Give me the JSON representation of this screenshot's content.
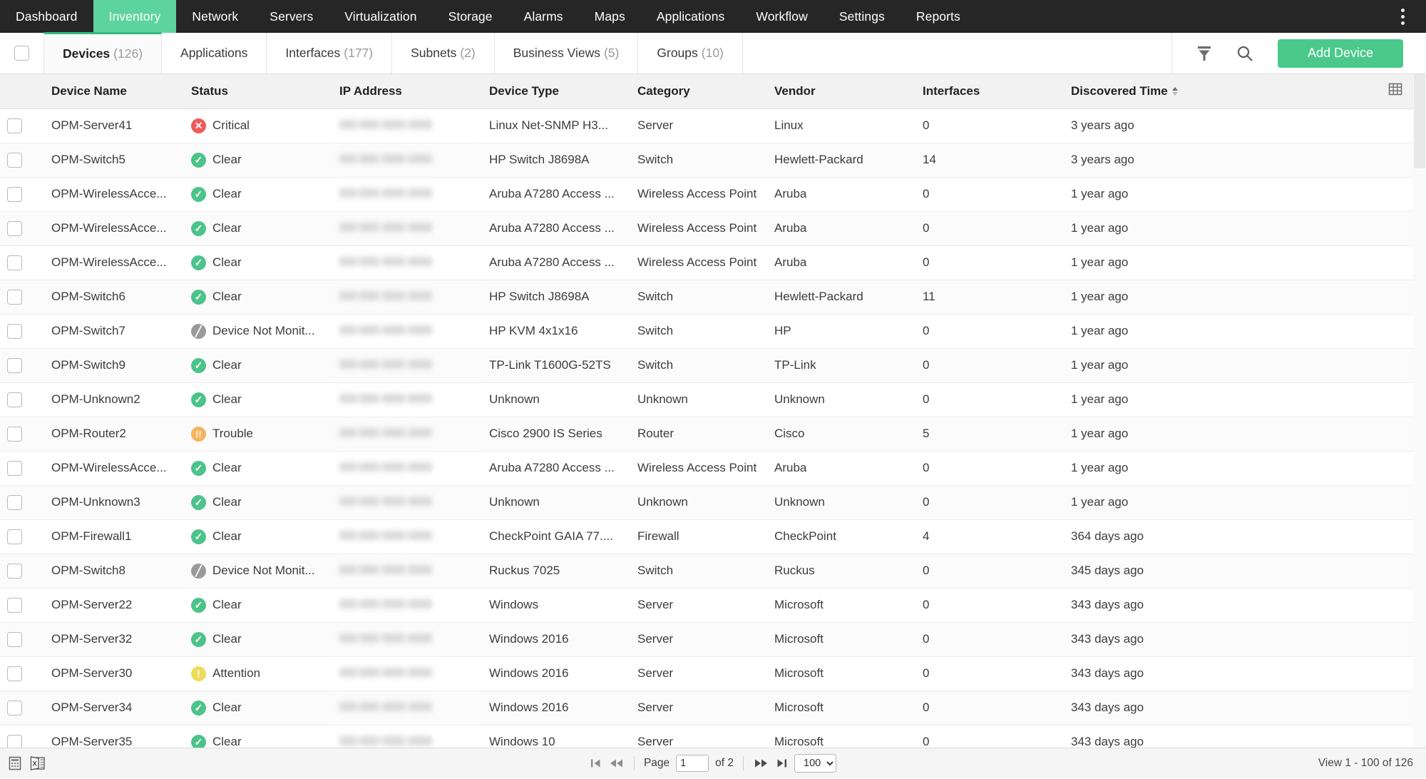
{
  "topnav": {
    "items": [
      {
        "label": "Dashboard",
        "active": false
      },
      {
        "label": "Inventory",
        "active": true
      },
      {
        "label": "Network",
        "active": false
      },
      {
        "label": "Servers",
        "active": false
      },
      {
        "label": "Virtualization",
        "active": false
      },
      {
        "label": "Storage",
        "active": false
      },
      {
        "label": "Alarms",
        "active": false
      },
      {
        "label": "Maps",
        "active": false
      },
      {
        "label": "Applications",
        "active": false
      },
      {
        "label": "Workflow",
        "active": false
      },
      {
        "label": "Settings",
        "active": false
      },
      {
        "label": "Reports",
        "active": false
      }
    ],
    "active_color": "#5dd39e",
    "background": "#262626"
  },
  "tabs": [
    {
      "label": "Devices",
      "count": "(126)",
      "active": true
    },
    {
      "label": "Applications",
      "count": "",
      "active": false
    },
    {
      "label": "Interfaces",
      "count": "(177)",
      "active": false
    },
    {
      "label": "Subnets",
      "count": "(2)",
      "active": false
    },
    {
      "label": "Business Views",
      "count": "(5)",
      "active": false
    },
    {
      "label": "Groups",
      "count": "(10)",
      "active": false
    }
  ],
  "toolbar": {
    "filter_icon": "filter-icon",
    "search_icon": "search-icon",
    "add_device_label": "Add Device",
    "add_device_color": "#4ac98b"
  },
  "table": {
    "columns": [
      "Device Name",
      "Status",
      "IP Address",
      "Device Type",
      "Category",
      "Vendor",
      "Interfaces",
      "Discovered Time"
    ],
    "sorted_column": "Discovered Time",
    "sort_direction": "asc",
    "column_chooser_icon": "grid-settings-icon",
    "rows": [
      {
        "name": "OPM-Server41",
        "status": "Critical",
        "status_type": "critical",
        "ip": "",
        "type": "Linux Net-SNMP H3...",
        "category": "Server",
        "vendor": "Linux",
        "interfaces": "0",
        "discovered": "3 years ago"
      },
      {
        "name": "OPM-Switch5",
        "status": "Clear",
        "status_type": "clear",
        "ip": "",
        "type": "HP Switch J8698A",
        "category": "Switch",
        "vendor": "Hewlett-Packard",
        "interfaces": "14",
        "discovered": "3 years ago"
      },
      {
        "name": "OPM-WirelessAcce...",
        "status": "Clear",
        "status_type": "clear",
        "ip": "",
        "type": "Aruba A7280 Access ...",
        "category": "Wireless Access Point",
        "vendor": "Aruba",
        "interfaces": "0",
        "discovered": "1 year ago"
      },
      {
        "name": "OPM-WirelessAcce...",
        "status": "Clear",
        "status_type": "clear",
        "ip": "",
        "type": "Aruba A7280 Access ...",
        "category": "Wireless Access Point",
        "vendor": "Aruba",
        "interfaces": "0",
        "discovered": "1 year ago"
      },
      {
        "name": "OPM-WirelessAcce...",
        "status": "Clear",
        "status_type": "clear",
        "ip": "",
        "type": "Aruba A7280 Access ...",
        "category": "Wireless Access Point",
        "vendor": "Aruba",
        "interfaces": "0",
        "discovered": "1 year ago"
      },
      {
        "name": "OPM-Switch6",
        "status": "Clear",
        "status_type": "clear",
        "ip": "",
        "type": "HP Switch J8698A",
        "category": "Switch",
        "vendor": "Hewlett-Packard",
        "interfaces": "11",
        "discovered": "1 year ago"
      },
      {
        "name": "OPM-Switch7",
        "status": "Device Not Monit...",
        "status_type": "nomon",
        "ip": "",
        "type": "HP KVM 4x1x16",
        "category": "Switch",
        "vendor": "HP",
        "interfaces": "0",
        "discovered": "1 year ago"
      },
      {
        "name": "OPM-Switch9",
        "status": "Clear",
        "status_type": "clear",
        "ip": "",
        "type": "TP-Link T1600G-52TS",
        "category": "Switch",
        "vendor": "TP-Link",
        "interfaces": "0",
        "discovered": "1 year ago"
      },
      {
        "name": "OPM-Unknown2",
        "status": "Clear",
        "status_type": "clear",
        "ip": "",
        "type": "Unknown",
        "category": "Unknown",
        "vendor": "Unknown",
        "interfaces": "0",
        "discovered": "1 year ago"
      },
      {
        "name": "OPM-Router2",
        "status": "Trouble",
        "status_type": "trouble",
        "ip": "",
        "type": "Cisco 2900 IS Series",
        "category": "Router",
        "vendor": "Cisco",
        "interfaces": "5",
        "discovered": "1 year ago"
      },
      {
        "name": "OPM-WirelessAcce...",
        "status": "Clear",
        "status_type": "clear",
        "ip": "",
        "type": "Aruba A7280 Access ...",
        "category": "Wireless Access Point",
        "vendor": "Aruba",
        "interfaces": "0",
        "discovered": "1 year ago"
      },
      {
        "name": "OPM-Unknown3",
        "status": "Clear",
        "status_type": "clear",
        "ip": "",
        "type": "Unknown",
        "category": "Unknown",
        "vendor": "Unknown",
        "interfaces": "0",
        "discovered": "1 year ago"
      },
      {
        "name": "OPM-Firewall1",
        "status": "Clear",
        "status_type": "clear",
        "ip": "",
        "type": "CheckPoint GAIA 77....",
        "category": "Firewall",
        "vendor": "CheckPoint",
        "interfaces": "4",
        "discovered": "364 days ago"
      },
      {
        "name": "OPM-Switch8",
        "status": "Device Not Monit...",
        "status_type": "nomon",
        "ip": "",
        "type": "Ruckus 7025",
        "category": "Switch",
        "vendor": "Ruckus",
        "interfaces": "0",
        "discovered": "345 days ago"
      },
      {
        "name": "OPM-Server22",
        "status": "Clear",
        "status_type": "clear",
        "ip": "",
        "type": "Windows",
        "category": "Server",
        "vendor": "Microsoft",
        "interfaces": "0",
        "discovered": "343 days ago"
      },
      {
        "name": "OPM-Server32",
        "status": "Clear",
        "status_type": "clear",
        "ip": "",
        "type": "Windows 2016",
        "category": "Server",
        "vendor": "Microsoft",
        "interfaces": "0",
        "discovered": "343 days ago"
      },
      {
        "name": "OPM-Server30",
        "status": "Attention",
        "status_type": "attention",
        "ip": "",
        "type": "Windows 2016",
        "category": "Server",
        "vendor": "Microsoft",
        "interfaces": "0",
        "discovered": "343 days ago"
      },
      {
        "name": "OPM-Server34",
        "status": "Clear",
        "status_type": "clear",
        "ip": "",
        "type": "Windows 2016",
        "category": "Server",
        "vendor": "Microsoft",
        "interfaces": "0",
        "discovered": "343 days ago"
      },
      {
        "name": "OPM-Server35",
        "status": "Clear",
        "status_type": "clear",
        "ip": "",
        "type": "Windows 10",
        "category": "Server",
        "vendor": "Microsoft",
        "interfaces": "0",
        "discovered": "343 days ago"
      }
    ]
  },
  "footer": {
    "export_pdf_icon": "export-pdf-icon",
    "export_excel_icon": "export-excel-icon",
    "first_page_icon": "first-page-icon",
    "prev_page_icon": "previous-page-icon",
    "page_label": "Page",
    "page_value": "1",
    "of_label": "of 2",
    "next_page_icon": "next-page-icon",
    "last_page_icon": "last-page-icon",
    "page_size": "100",
    "page_size_options": [
      "100"
    ],
    "view_range": "View 1 - 100 of 126"
  },
  "status_colors": {
    "clear": "#4cc38a",
    "critical": "#ef5a5a",
    "trouble": "#f7b35c",
    "attention": "#efdb5a",
    "nomon": "#9a9a9a"
  }
}
